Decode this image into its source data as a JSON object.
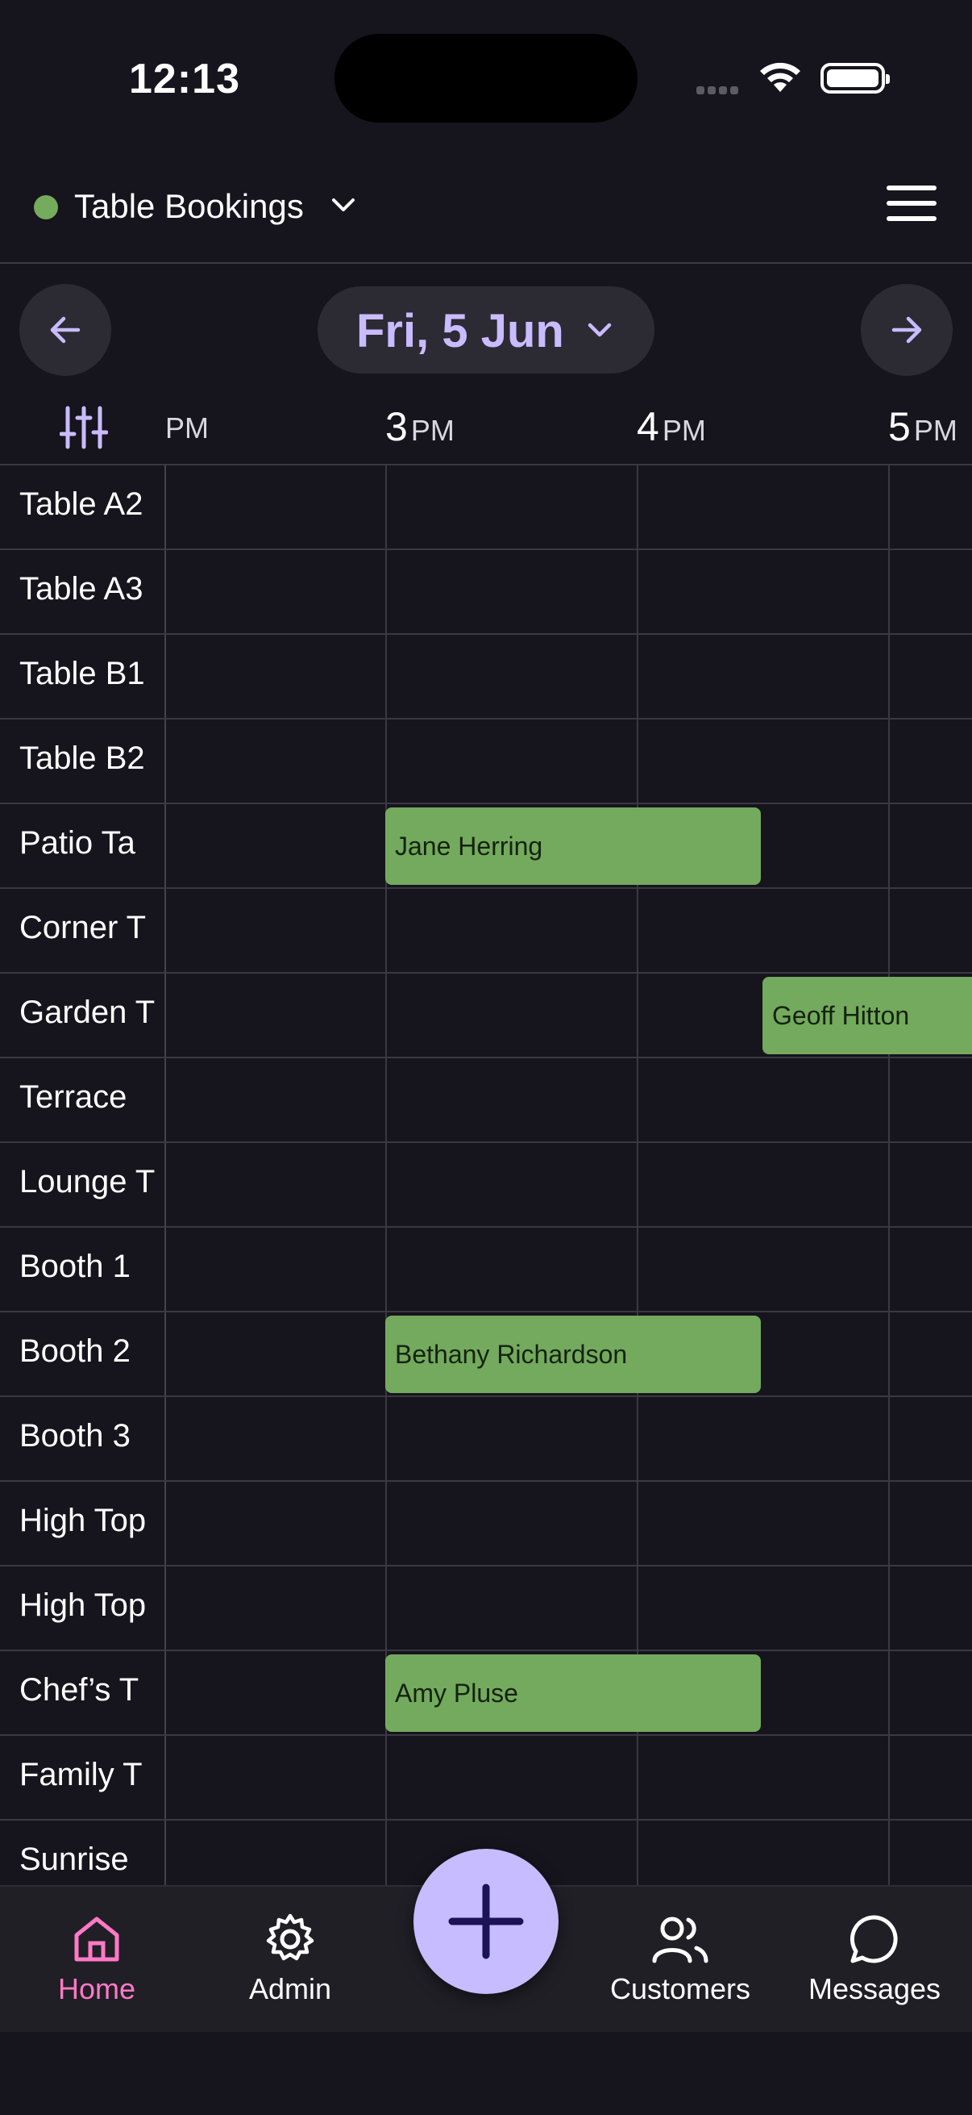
{
  "status_bar": {
    "time": "12:13"
  },
  "header": {
    "title": "Table Bookings",
    "status_color": "#74ab5c"
  },
  "date_nav": {
    "date": "Fri, 5 Jun"
  },
  "timeline": {
    "partial_label": "PM",
    "hours": [
      {
        "hour": "3",
        "suffix": "PM"
      },
      {
        "hour": "4",
        "suffix": "PM"
      },
      {
        "hour": "5",
        "suffix": "PM"
      }
    ]
  },
  "tables": [
    "Table A2",
    "Table A3",
    "Table B1",
    "Table B2",
    "Patio Ta",
    "Corner T",
    "Garden T",
    "Terrace",
    "Lounge T",
    "Booth 1",
    "Booth 2",
    "Booth 3",
    "High Top",
    "High Top",
    "Chef’s T",
    "Family T",
    "Sunrise"
  ],
  "bookings": [
    {
      "row": 4,
      "name": "Jane Herring",
      "start": "3:00 PM",
      "end": "4:30 PM"
    },
    {
      "row": 6,
      "name": "Geoff Hitton",
      "start": "4:30 PM",
      "end": "5:30 PM"
    },
    {
      "row": 10,
      "name": "Bethany Richardson",
      "start": "3:00 PM",
      "end": "4:30 PM"
    },
    {
      "row": 14,
      "name": "Amy Pluse",
      "start": "3:00 PM",
      "end": "4:30 PM"
    }
  ],
  "bottom_nav": {
    "home": "Home",
    "admin": "Admin",
    "customers": "Customers",
    "messages": "Messages"
  },
  "colors": {
    "accent": "#c6bcff",
    "active_tab": "#ff7ac6",
    "booking": "#73aa5d",
    "background": "#16141c"
  }
}
